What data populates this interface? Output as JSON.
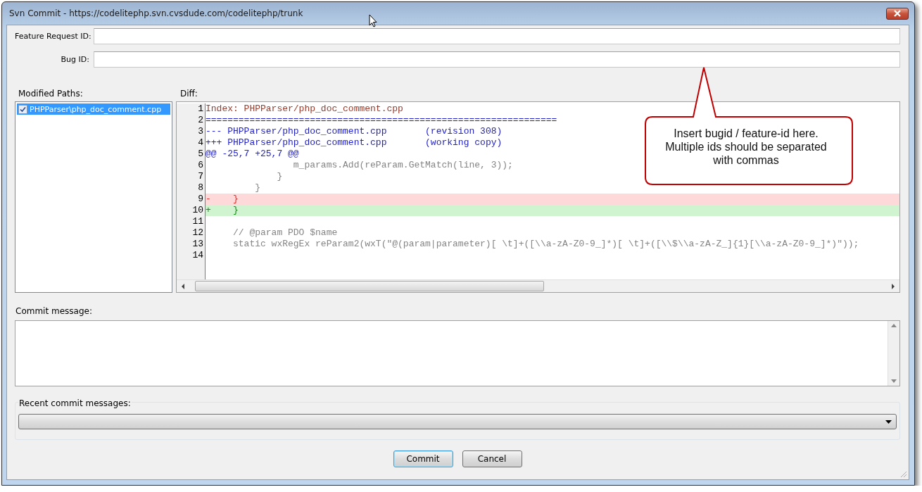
{
  "window": {
    "title": "Svn Commit - https://codelitephp.svn.cvsdude.com/codelitephp/trunk"
  },
  "fields": [
    {
      "label": "Feature Request ID:"
    },
    {
      "label": "Bug ID:"
    }
  ],
  "modified_paths": {
    "label": "Modified Paths:",
    "items": [
      {
        "label": "PHPParser\\php_doc_comment.cpp",
        "checked": true,
        "selected": true
      }
    ]
  },
  "diff": {
    "label": "Diff:",
    "lines": [
      {
        "number": "1",
        "kind": "header",
        "text": "Index: PHPParser/php_doc_comment.cpp"
      },
      {
        "number": "2",
        "kind": "separator",
        "text": "================================================================"
      },
      {
        "number": "3",
        "kind": "from",
        "text": "--- PHPParser/php_doc_comment.cpp\t(revision 308)"
      },
      {
        "number": "4",
        "kind": "to",
        "text": "+++ PHPParser/php_doc_comment.cpp\t(working copy)"
      },
      {
        "number": "5",
        "kind": "hunk",
        "text": "@@ -25,7 +25,7 @@"
      },
      {
        "number": "6",
        "kind": "context",
        "text": "                m_params.Add(reParam.GetMatch(line, 3));"
      },
      {
        "number": "7",
        "kind": "context",
        "text": "             }"
      },
      {
        "number": "8",
        "kind": "context",
        "text": "         }"
      },
      {
        "number": "9",
        "kind": "removed",
        "text": "-    }"
      },
      {
        "number": "10",
        "kind": "added",
        "text": "+    }"
      },
      {
        "number": "11",
        "kind": "context"
      },
      {
        "number": "12",
        "kind": "context",
        "text": "     // @param PDO $name"
      },
      {
        "number": "13",
        "kind": "context",
        "text": "     static wxRegEx reParam2(wxT(\"@(param|parameter)[ \\t]+([\\\\a-zA-Z0-9_]*)[ \\t]+([\\\\$\\\\a-zA-Z_]{1}[\\\\a-zA-Z0-9_]*)\"));"
      },
      {
        "number": "14",
        "kind": "context"
      }
    ]
  },
  "callout": {
    "text": "Insert bugid / feature-id here. Multiple ids should be separated with commas"
  },
  "commit_message": {
    "label": "Commit message:"
  },
  "recent_messages": {
    "label": "Recent commit messages:"
  },
  "buttons": [
    {
      "label": "Commit",
      "default": true
    },
    {
      "label": "Cancel",
      "default": false
    }
  ]
}
